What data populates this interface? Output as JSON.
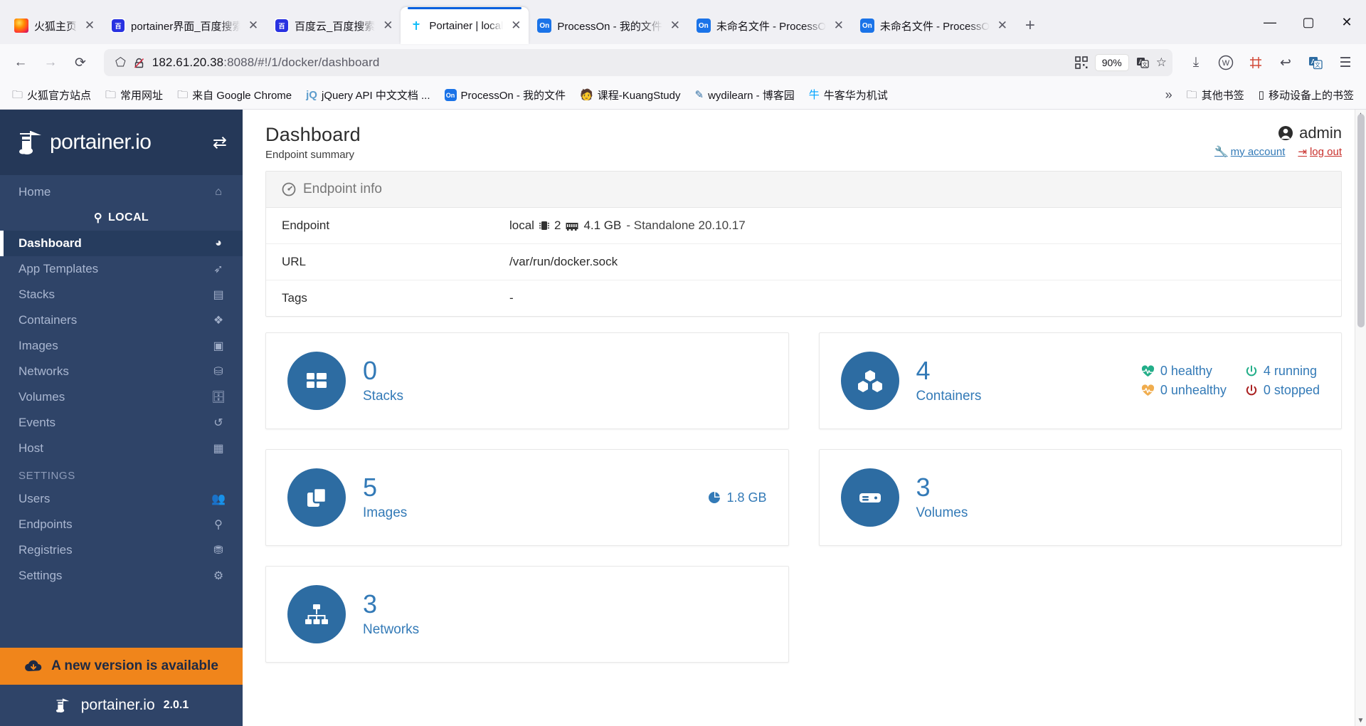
{
  "browser": {
    "tabs": [
      {
        "title": "火狐主页",
        "favicon": "firefox-icon",
        "active": false
      },
      {
        "title": "portainer界面_百度搜索",
        "favicon": "baidu-icon",
        "active": false
      },
      {
        "title": "百度云_百度搜索",
        "favicon": "baidu-icon",
        "active": false
      },
      {
        "title": "Portainer | local",
        "favicon": "portainer-icon",
        "active": true
      },
      {
        "title": "ProcessOn - 我的文件",
        "favicon": "processon-icon",
        "active": false
      },
      {
        "title": "未命名文件 - ProcessOn",
        "favicon": "processon-icon",
        "active": false
      },
      {
        "title": "未命名文件 - ProcessOn",
        "favicon": "processon-icon",
        "active": false
      }
    ],
    "new_tab_label": "+",
    "window_controls": {
      "minimize": "—",
      "maximize": "▢",
      "close": "✕"
    },
    "nav": {
      "back": "back-arrow-icon",
      "forward": "forward-arrow-icon",
      "reload": "reload-icon"
    },
    "url": {
      "host": "182.61.20.38",
      "path": ":8088/#!/1/docker/dashboard"
    },
    "zoom_level": "90%",
    "toolbar_icons": [
      "qr-code-icon",
      "translate-icon",
      "bookmark-star-icon",
      "download-icon",
      "w-account-icon",
      "screenshot-icon",
      "undo-icon",
      "translate-page-icon",
      "hamburger-menu-icon"
    ],
    "account_badge": "W",
    "bookmarks": [
      {
        "label": "火狐官方站点",
        "icon": "folder-icon"
      },
      {
        "label": "常用网址",
        "icon": "folder-icon"
      },
      {
        "label": "来自 Google Chrome",
        "icon": "folder-icon"
      },
      {
        "label": "jQuery API 中文文档 ...",
        "icon": "jquery-icon"
      },
      {
        "label": "ProcessOn - 我的文件",
        "icon": "processon-icon"
      },
      {
        "label": "课程-KuangStudy",
        "icon": "kuang-icon"
      },
      {
        "label": "wydilearn - 博客园",
        "icon": "cnblogs-icon"
      },
      {
        "label": "牛客华为机试",
        "icon": "nowcoder-icon"
      }
    ],
    "bookmarks_overflow": "»",
    "bookmarks_right": [
      {
        "label": "其他书签",
        "icon": "folder-icon"
      },
      {
        "label": "移动设备上的书签",
        "icon": "mobile-icon"
      }
    ]
  },
  "sidebar": {
    "brand": "portainer.io",
    "toggle_icon": "collapse-sidebar-icon",
    "home": {
      "label": "Home",
      "icon": "home-icon"
    },
    "local_section": {
      "label": "LOCAL",
      "icon": "plug-icon"
    },
    "items": [
      {
        "label": "Dashboard",
        "icon": "dashboard-icon",
        "active": true
      },
      {
        "label": "App Templates",
        "icon": "rocket-icon",
        "active": false
      },
      {
        "label": "Stacks",
        "icon": "stacks-icon",
        "active": false
      },
      {
        "label": "Containers",
        "icon": "containers-icon",
        "active": false
      },
      {
        "label": "Images",
        "icon": "images-icon",
        "active": false
      },
      {
        "label": "Networks",
        "icon": "networks-icon",
        "active": false
      },
      {
        "label": "Volumes",
        "icon": "volumes-icon",
        "active": false
      },
      {
        "label": "Events",
        "icon": "events-icon",
        "active": false
      },
      {
        "label": "Host",
        "icon": "host-icon",
        "active": false
      }
    ],
    "settings_header": "SETTINGS",
    "settings_items": [
      {
        "label": "Users",
        "icon": "users-icon"
      },
      {
        "label": "Endpoints",
        "icon": "plug-icon"
      },
      {
        "label": "Registries",
        "icon": "database-icon"
      },
      {
        "label": "Settings",
        "icon": "gear-icon"
      }
    ],
    "update_banner": {
      "label": "A new version is available",
      "icon": "cloud-download-icon",
      "color": "#f0851b"
    },
    "footer": {
      "brand": "portainer.io",
      "version": "2.0.1"
    }
  },
  "header": {
    "title": "Dashboard",
    "subtitle": "Endpoint summary",
    "user": "admin",
    "user_icon": "user-circle-icon",
    "my_account": "my account",
    "my_account_icon": "wrench-icon",
    "log_out": "log out",
    "log_out_icon": "logout-icon"
  },
  "endpoint_info": {
    "panel_title": "Endpoint info",
    "panel_icon": "gauge-icon",
    "rows": [
      {
        "key": "Endpoint",
        "value": "local",
        "cpu": "2",
        "memory": "4.1 GB",
        "suffix": "- Standalone 20.10.17"
      },
      {
        "key": "URL",
        "value": "/var/run/docker.sock"
      },
      {
        "key": "Tags",
        "value": "-"
      }
    ]
  },
  "cards": [
    {
      "count": "0",
      "label": "Stacks",
      "icon": "stacks-icon"
    },
    {
      "count": "4",
      "label": "Containers",
      "icon": "containers-icon",
      "stats": [
        {
          "label": "0 healthy",
          "icon": "heartbeat-icon",
          "color": "#23ae89"
        },
        {
          "label": "4 running",
          "icon": "power-icon",
          "color": "#23ae89"
        },
        {
          "label": "0 unhealthy",
          "icon": "heartbeat-icon",
          "color": "#f0ad4e"
        },
        {
          "label": "0 stopped",
          "icon": "power-icon",
          "color": "#ab2222"
        }
      ]
    },
    {
      "count": "5",
      "label": "Images",
      "icon": "images-icon",
      "size": "1.8 GB",
      "size_icon": "pie-chart-icon"
    },
    {
      "count": "3",
      "label": "Volumes",
      "icon": "volumes-icon"
    },
    {
      "count": "3",
      "label": "Networks",
      "icon": "networks-icon"
    }
  ],
  "theme": {
    "sidebar_bg": "#2f4468",
    "sidebar_dark": "#253858",
    "accent_blue": "#337ab7",
    "icon_circle": "#2d6ca2",
    "orange": "#f0851b"
  }
}
